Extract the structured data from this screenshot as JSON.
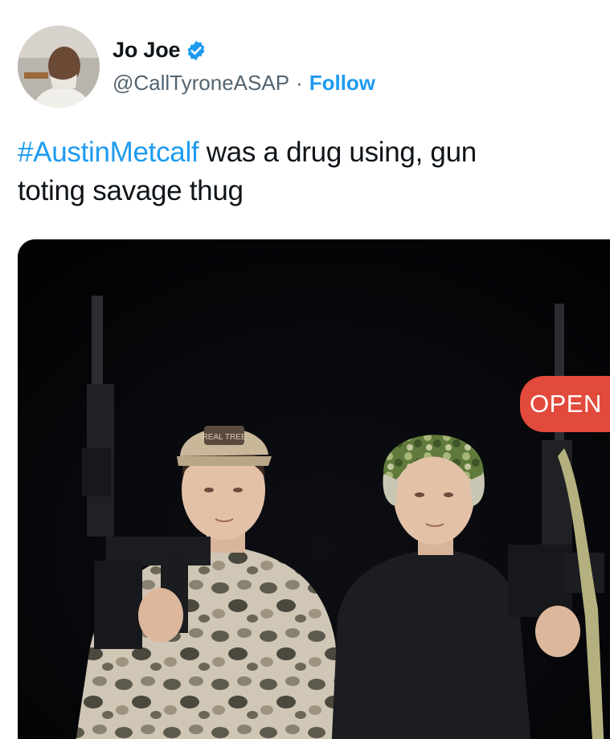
{
  "author": {
    "display_name": "Jo Joe",
    "handle": "@CallTyroneASAP",
    "separator": "·",
    "follow_label": "Follow",
    "verified": true,
    "verified_color": "#1d9bf0"
  },
  "tweet": {
    "hashtag": "#AustinMetcalf",
    "text_line1": " was a drug using, gun",
    "text_line2": "toting savage thug",
    "hashtag_color": "#1d9bf0"
  },
  "media": {
    "badge_label": "OPEN",
    "badge_color": "#e24a3b",
    "hat_patch_text": "REAL TREE"
  }
}
